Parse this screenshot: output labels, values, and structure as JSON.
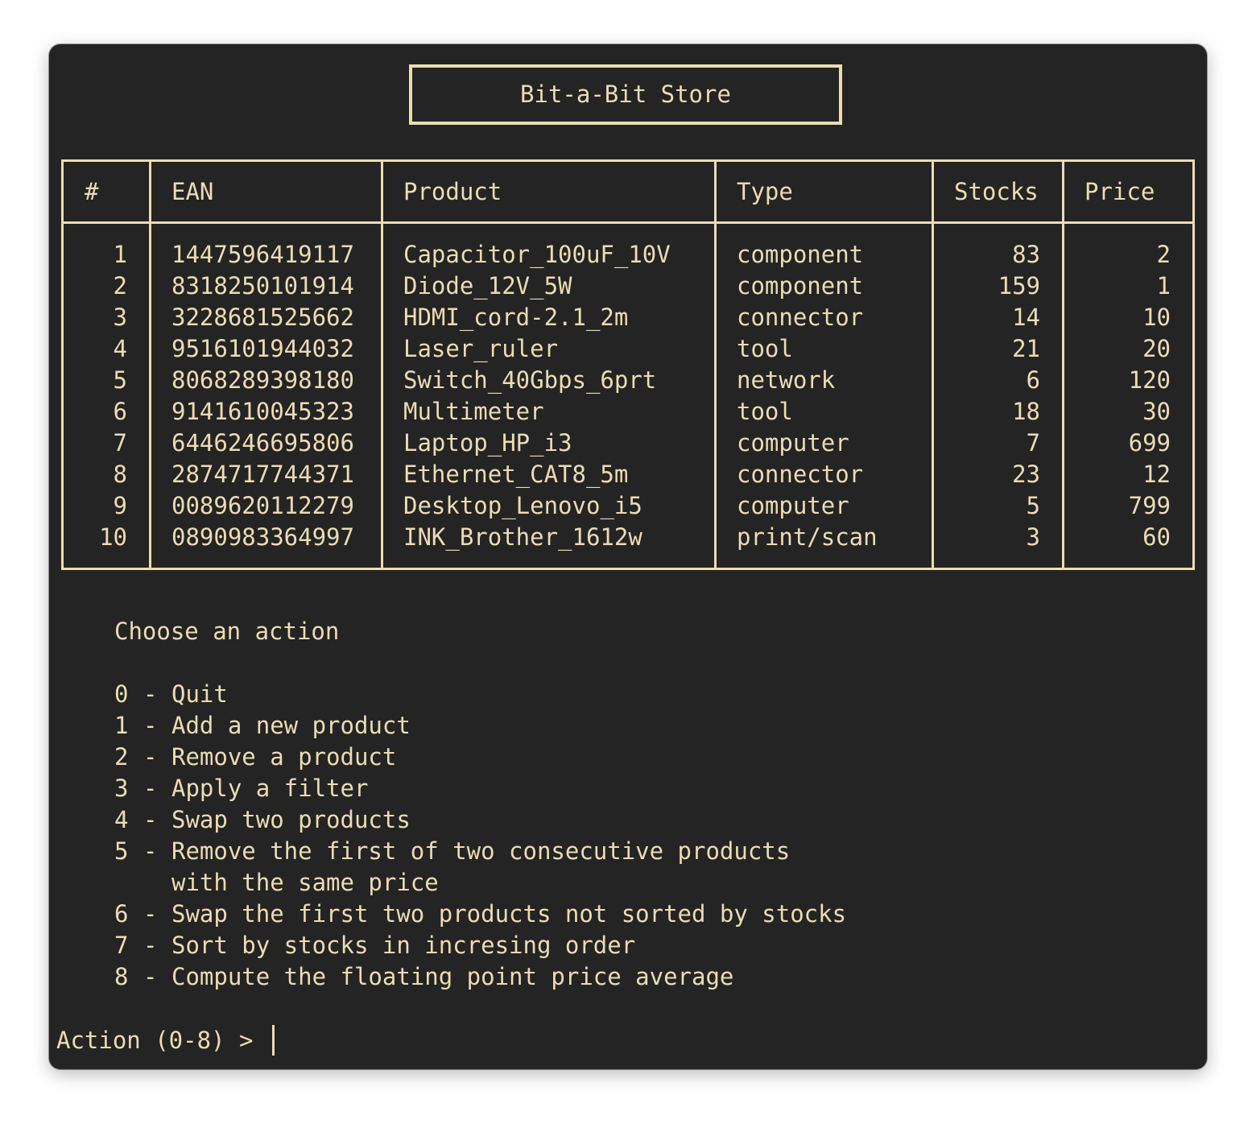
{
  "title": "Bit-a-Bit Store",
  "table": {
    "headers": [
      "#",
      "EAN",
      "Product",
      "Type",
      "Stocks",
      "Price"
    ],
    "rows": [
      {
        "num": "1",
        "ean": "1447596419117",
        "product": "Capacitor_100uF_10V",
        "type": "component",
        "stocks": "83",
        "price": "2"
      },
      {
        "num": "2",
        "ean": "8318250101914",
        "product": "Diode_12V_5W",
        "type": "component",
        "stocks": "159",
        "price": "1"
      },
      {
        "num": "3",
        "ean": "3228681525662",
        "product": "HDMI_cord-2.1_2m",
        "type": "connector",
        "stocks": "14",
        "price": "10"
      },
      {
        "num": "4",
        "ean": "9516101944032",
        "product": "Laser_ruler",
        "type": "tool",
        "stocks": "21",
        "price": "20"
      },
      {
        "num": "5",
        "ean": "8068289398180",
        "product": "Switch_40Gbps_6prt",
        "type": "network",
        "stocks": "6",
        "price": "120"
      },
      {
        "num": "6",
        "ean": "9141610045323",
        "product": "Multimeter",
        "type": "tool",
        "stocks": "18",
        "price": "30"
      },
      {
        "num": "7",
        "ean": "6446246695806",
        "product": "Laptop_HP_i3",
        "type": "computer",
        "stocks": "7",
        "price": "699"
      },
      {
        "num": "8",
        "ean": "2874717744371",
        "product": "Ethernet_CAT8_5m",
        "type": "connector",
        "stocks": "23",
        "price": "12"
      },
      {
        "num": "9",
        "ean": "0089620112279",
        "product": "Desktop_Lenovo_i5",
        "type": "computer",
        "stocks": "5",
        "price": "799"
      },
      {
        "num": "10",
        "ean": "0890983364997",
        "product": "INK_Brother_1612w",
        "type": "print/scan",
        "stocks": "3",
        "price": "60"
      }
    ]
  },
  "menu": {
    "heading": "Choose an action",
    "items": [
      {
        "key": "0",
        "label": "Quit"
      },
      {
        "key": "1",
        "label": "Add a new product"
      },
      {
        "key": "2",
        "label": "Remove a product"
      },
      {
        "key": "3",
        "label": "Apply a filter"
      },
      {
        "key": "4",
        "label": "Swap two products"
      },
      {
        "key": "5",
        "label": "Remove the first of two consecutive products",
        "label_cont": "with the same price"
      },
      {
        "key": "6",
        "label": "Swap the first two products not sorted by stocks"
      },
      {
        "key": "7",
        "label": "Sort by stocks in incresing order"
      },
      {
        "key": "8",
        "label": "Compute the floating point price average"
      }
    ]
  },
  "prompt": {
    "text": "Action (0-8) > ",
    "value": ""
  },
  "colors": {
    "background": "#242424",
    "foreground": "#ecdcb4"
  }
}
